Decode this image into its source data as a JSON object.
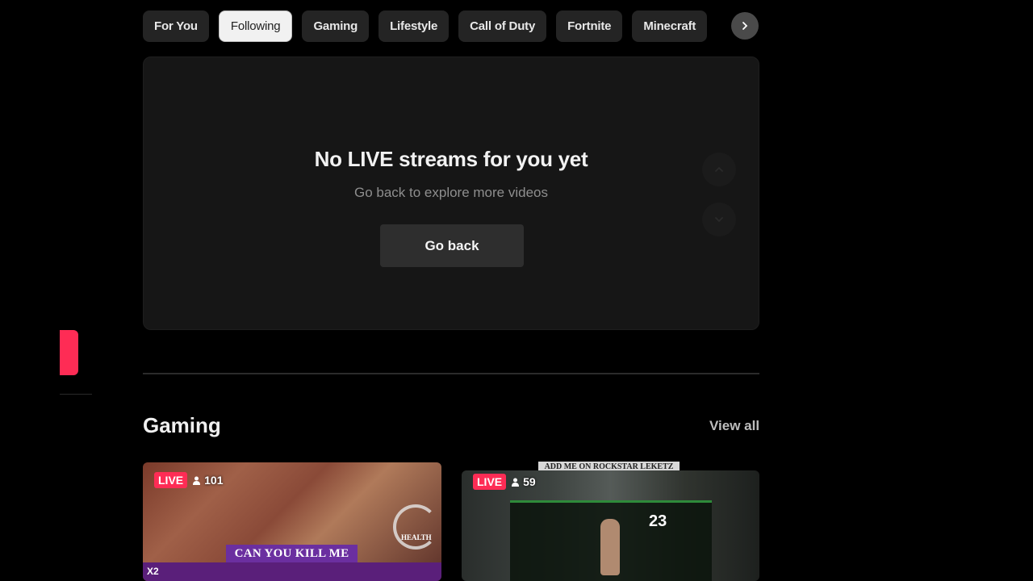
{
  "tabs": {
    "items": [
      "For You",
      "Following",
      "Gaming",
      "Lifestyle",
      "Call of Duty",
      "Fortnite",
      "Minecraft"
    ],
    "active": "Following",
    "next_icon": "chevron-right-icon"
  },
  "empty_state": {
    "title": "No LIVE streams for you yet",
    "subtitle": "Go back to explore more videos",
    "button_label": "Go back",
    "up_icon": "chevron-up-icon",
    "down_icon": "chevron-down-icon"
  },
  "section": {
    "title": "Gaming",
    "view_all": "View all"
  },
  "streams": [
    {
      "badge": "LIVE",
      "viewers": "101",
      "overlay_banner": "CAN YOU KILL ME",
      "hud_label": "HEALTH",
      "hud_multiplier": "X2"
    },
    {
      "badge": "LIVE",
      "viewers": "59",
      "overlay_banner": "ADD ME ON ROCKSTAR LEKETZ",
      "stat_value": "23"
    }
  ],
  "colors": {
    "accent": "#fe2c55",
    "background": "#000000",
    "panel": "#161616"
  }
}
